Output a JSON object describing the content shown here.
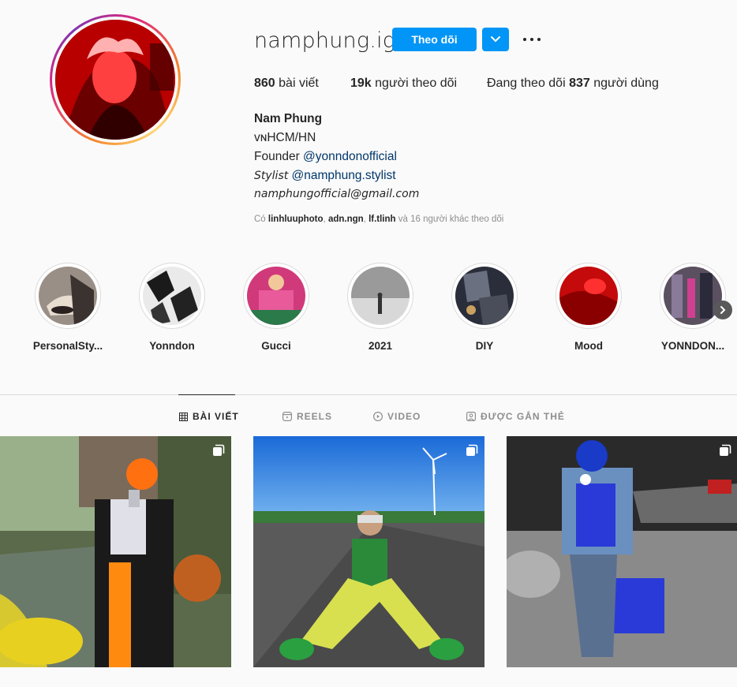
{
  "profile": {
    "username": "namphung.ig",
    "follow_label": "Theo dõi",
    "stats": {
      "posts_count": "860",
      "posts_label": "bài viết",
      "followers_count": "19k",
      "followers_label": "người theo dõi",
      "following_prefix": "Đang theo dõi",
      "following_count": "837",
      "following_suffix": "người dùng"
    },
    "bio": {
      "name": "Nam Phung",
      "location": "ᴠɴHCM/HN",
      "founder_prefix": "Founder",
      "founder_handle": "@yonndonofficial",
      "stylist_prefix": "Stylist",
      "stylist_handle": "@namphung.stylist",
      "email": "namphungofficial@gmail.com"
    },
    "followed_by": {
      "prefix": "Có",
      "user1": "linhluuphoto",
      "sep1": ",",
      "user2": "adn.ngn",
      "sep2": ",",
      "user3": "lf.tlinh",
      "suffix": "và 16 người khác theo dõi"
    }
  },
  "highlights": [
    {
      "label": "PersonalSty..."
    },
    {
      "label": "Yonndon"
    },
    {
      "label": "Gucci"
    },
    {
      "label": "2021"
    },
    {
      "label": "DIY"
    },
    {
      "label": "Mood"
    },
    {
      "label": "YONNDON..."
    }
  ],
  "tabs": [
    {
      "label": "BÀI VIẾT",
      "icon": "grid-icon",
      "active": true
    },
    {
      "label": "REELS",
      "icon": "reels-icon",
      "active": false
    },
    {
      "label": "VIDEO",
      "icon": "video-icon",
      "active": false
    },
    {
      "label": "ĐƯỢC GẮN THẺ",
      "icon": "tagged-icon",
      "active": false
    }
  ],
  "posts": [
    {
      "type": "carousel",
      "icon": "multiple-photos-icon"
    },
    {
      "type": "carousel",
      "icon": "multiple-photos-icon"
    },
    {
      "type": "carousel",
      "icon": "multiple-photos-icon"
    }
  ],
  "colors": {
    "accent": "#0095f6",
    "link": "#00376b",
    "muted": "#8e8e8e",
    "text": "#262626"
  }
}
